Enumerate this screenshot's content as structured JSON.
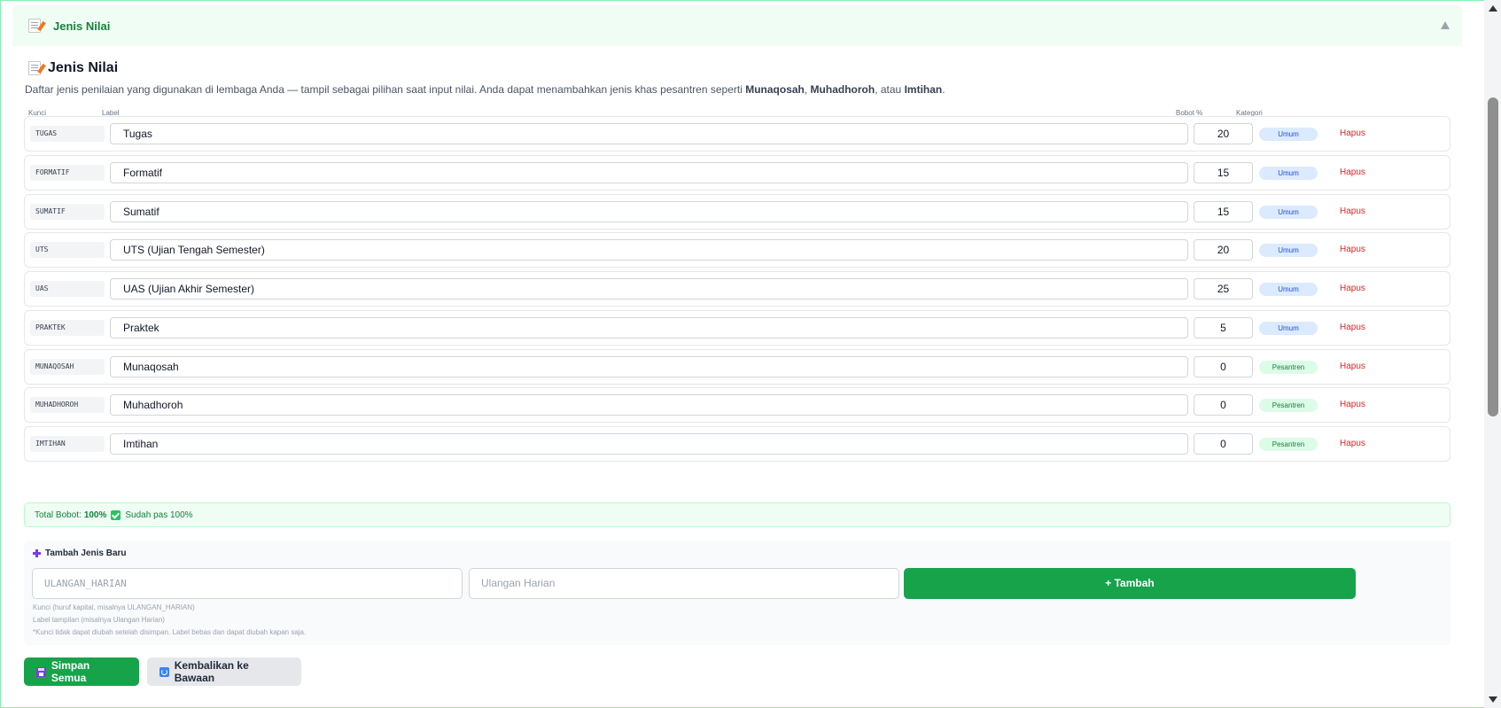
{
  "section": {
    "title": "Jenis Nilai"
  },
  "card": {
    "title": "Jenis Nilai",
    "description_prefix": "Daftar jenis penilaian yang digunakan di lembaga Anda — tampil sebagai pilihan saat input nilai. Anda dapat menambahkan jenis khas pesantren seperti ",
    "description_b1": "Munaqosah",
    "description_sep1": ", ",
    "description_b2": "Muhadhoroh",
    "description_sep2": ", atau ",
    "description_b3": "Imtihan",
    "description_end": "."
  },
  "columns": {
    "key": "Kunci",
    "label": "Label",
    "bobot": "Bobot %",
    "kategori": "Kategori"
  },
  "rows": [
    {
      "key": "TUGAS",
      "label": "Tugas",
      "bobot": "20",
      "kategori": "Umum",
      "delete": "Hapus"
    },
    {
      "key": "FORMATIF",
      "label": "Formatif",
      "bobot": "15",
      "kategori": "Umum",
      "delete": "Hapus"
    },
    {
      "key": "SUMATIF",
      "label": "Sumatif",
      "bobot": "15",
      "kategori": "Umum",
      "delete": "Hapus"
    },
    {
      "key": "UTS",
      "label": "UTS (Ujian Tengah Semester)",
      "bobot": "20",
      "kategori": "Umum",
      "delete": "Hapus"
    },
    {
      "key": "UAS",
      "label": "UAS (Ujian Akhir Semester)",
      "bobot": "25",
      "kategori": "Umum",
      "delete": "Hapus"
    },
    {
      "key": "PRAKTEK",
      "label": "Praktek",
      "bobot": "5",
      "kategori": "Umum",
      "delete": "Hapus"
    },
    {
      "key": "MUNAQOSAH",
      "label": "Munaqosah",
      "bobot": "0",
      "kategori": "Pesantren",
      "delete": "Hapus"
    },
    {
      "key": "MUHADHOROH",
      "label": "Muhadhoroh",
      "bobot": "0",
      "kategori": "Pesantren",
      "delete": "Hapus"
    },
    {
      "key": "IMTIHAN",
      "label": "Imtihan",
      "bobot": "0",
      "kategori": "Pesantren",
      "delete": "Hapus"
    }
  ],
  "total": {
    "prefix": "Total Bobot:",
    "value": "100%",
    "status": "Sudah pas 100%"
  },
  "add_form": {
    "title": "Tambah Jenis Baru",
    "key_placeholder": "ULANGAN_HARIAN",
    "label_placeholder": "Ulangan Harian",
    "button": "+ Tambah",
    "hint_key": "Kunci (huruf kapital, misalnya ULANGAN_HARIAN)",
    "hint_label": "Label tampilan (misalnya Ulangan Harian)",
    "hint_note": "*Kunci tidak dapat diubah setelah disimpan. Label bebas dan dapat diubah kapan saja."
  },
  "actions": {
    "save": "Simpan Semua",
    "reset": "Kembalikan ke Bawaan"
  },
  "colors": {
    "primary": "#16a34a",
    "umum_badge": "#dbeafe",
    "pesantren_badge": "#dcfce7",
    "danger": "#dc2626"
  },
  "icons": [
    "memo-icon",
    "chevron-up-icon",
    "check-icon",
    "plus-icon",
    "floppy-icon",
    "refresh-icon"
  ]
}
